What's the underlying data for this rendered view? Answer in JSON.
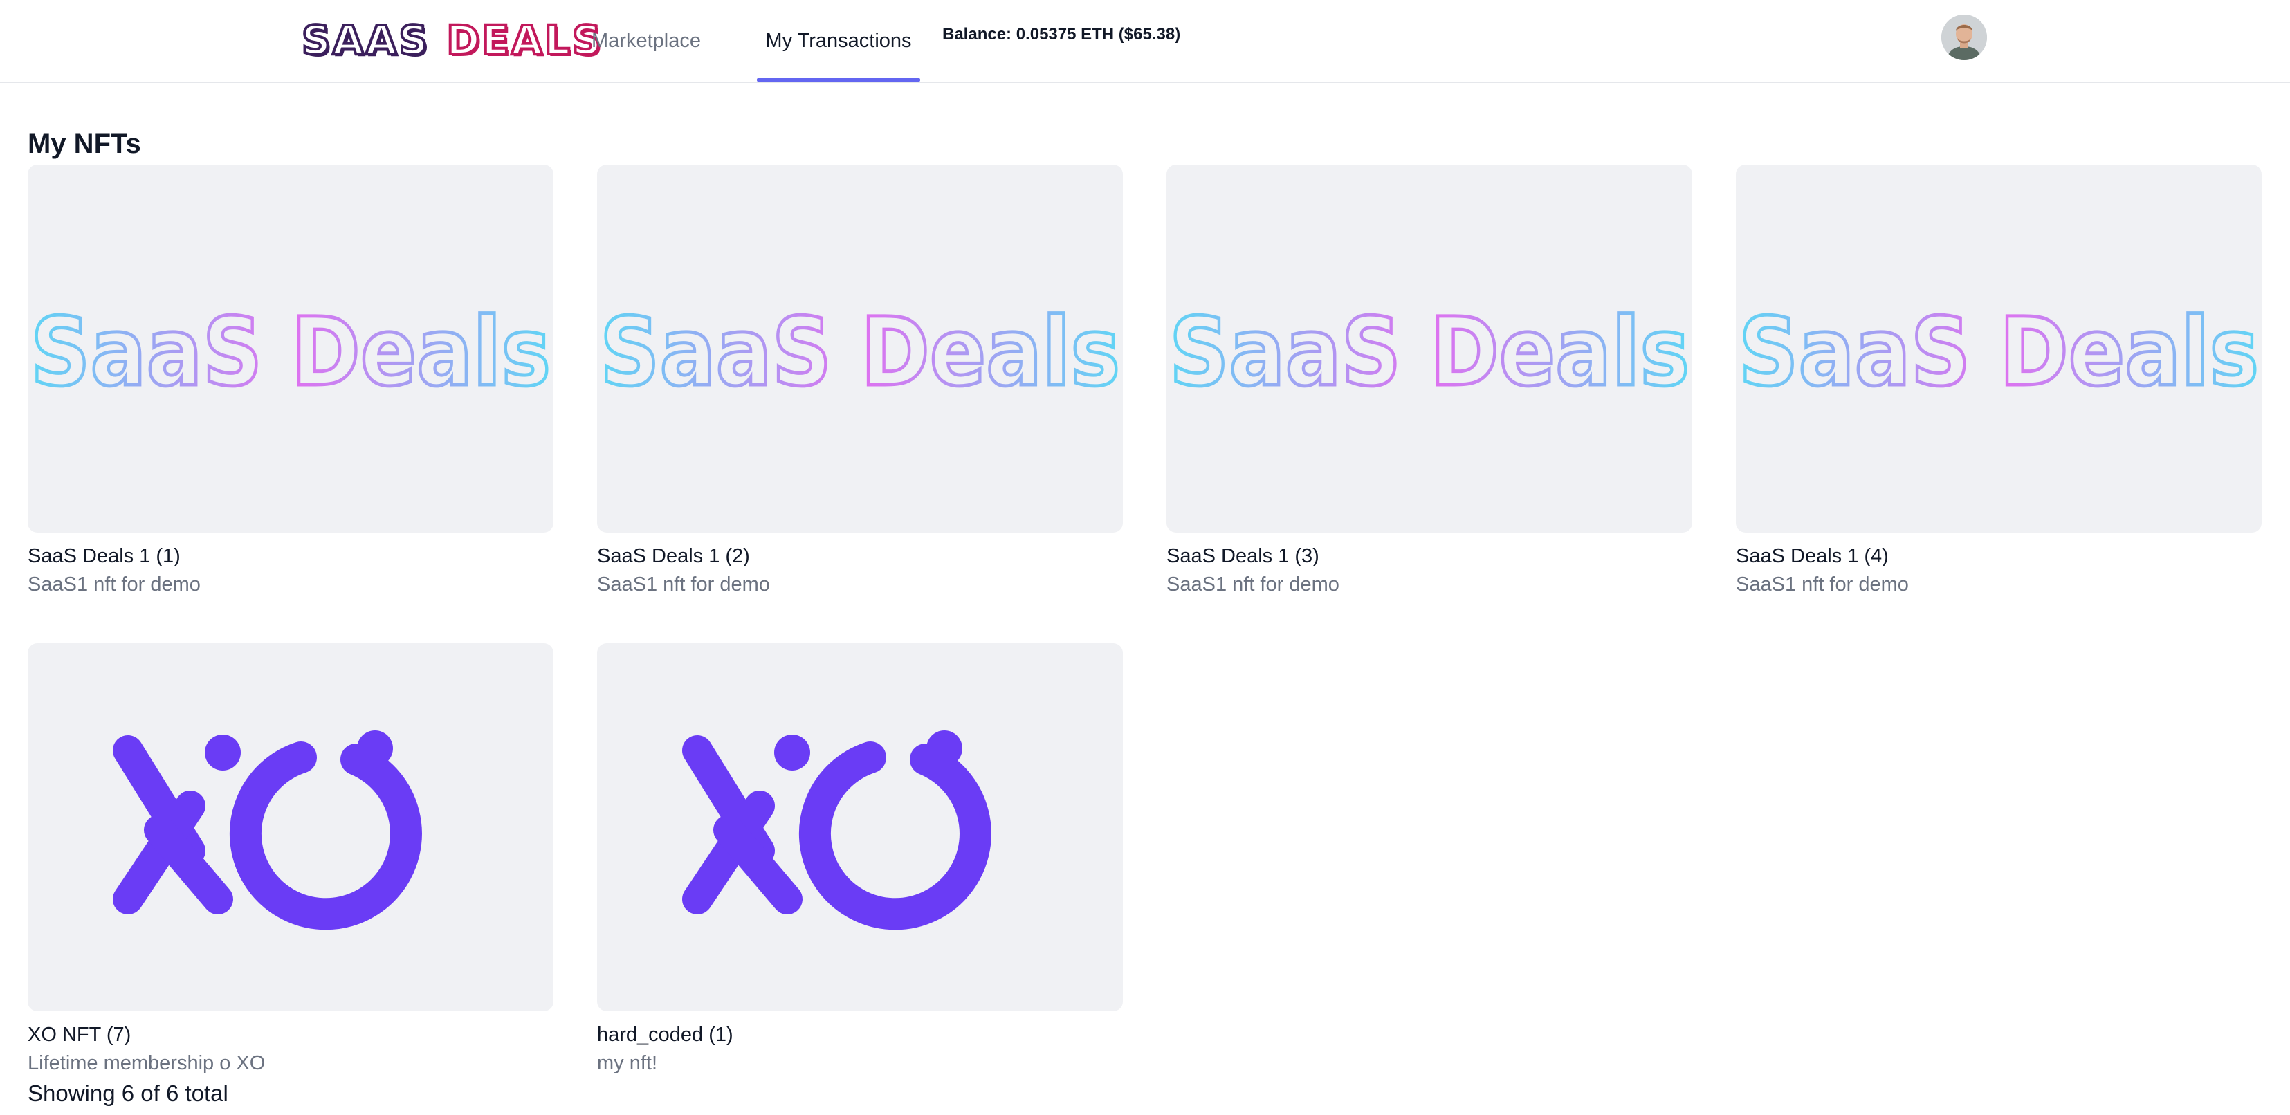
{
  "app": {
    "logo_word1": "SAAS",
    "logo_word2": "DEALS",
    "brand_colors": {
      "saas": "#3b1f5c",
      "deals": "#c2185b",
      "accent": "#6366f1",
      "xo": "#6a3cf5"
    }
  },
  "nav": {
    "marketplace": "Marketplace",
    "transactions": "My Transactions",
    "active": "My Transactions"
  },
  "balance": "Balance: 0.05375 ETH ($65.38)",
  "avatar_icon": "user-avatar",
  "main": {
    "title": "My NFTs",
    "cards": [
      {
        "image": "saas-deals-logo",
        "image_text": "SaaS Deals",
        "title": "SaaS Deals 1 (1)",
        "desc": "SaaS1 nft for demo"
      },
      {
        "image": "saas-deals-logo",
        "image_text": "SaaS Deals",
        "title": "SaaS Deals 1 (2)",
        "desc": "SaaS1 nft for demo"
      },
      {
        "image": "saas-deals-logo",
        "image_text": "SaaS Deals",
        "title": "SaaS Deals 1 (3)",
        "desc": "SaaS1 nft for demo"
      },
      {
        "image": "saas-deals-logo",
        "image_text": "SaaS Deals",
        "title": "SaaS Deals 1 (4)",
        "desc": "SaaS1 nft for demo"
      },
      {
        "image": "xo-logo",
        "image_text": "",
        "title": "XO NFT (7)",
        "desc": "Lifetime membership o XO"
      },
      {
        "image": "xo-logo",
        "image_text": "",
        "title": "hard_coded (1)",
        "desc": "my nft!"
      }
    ],
    "footer": "Showing 6 of 6 total"
  }
}
